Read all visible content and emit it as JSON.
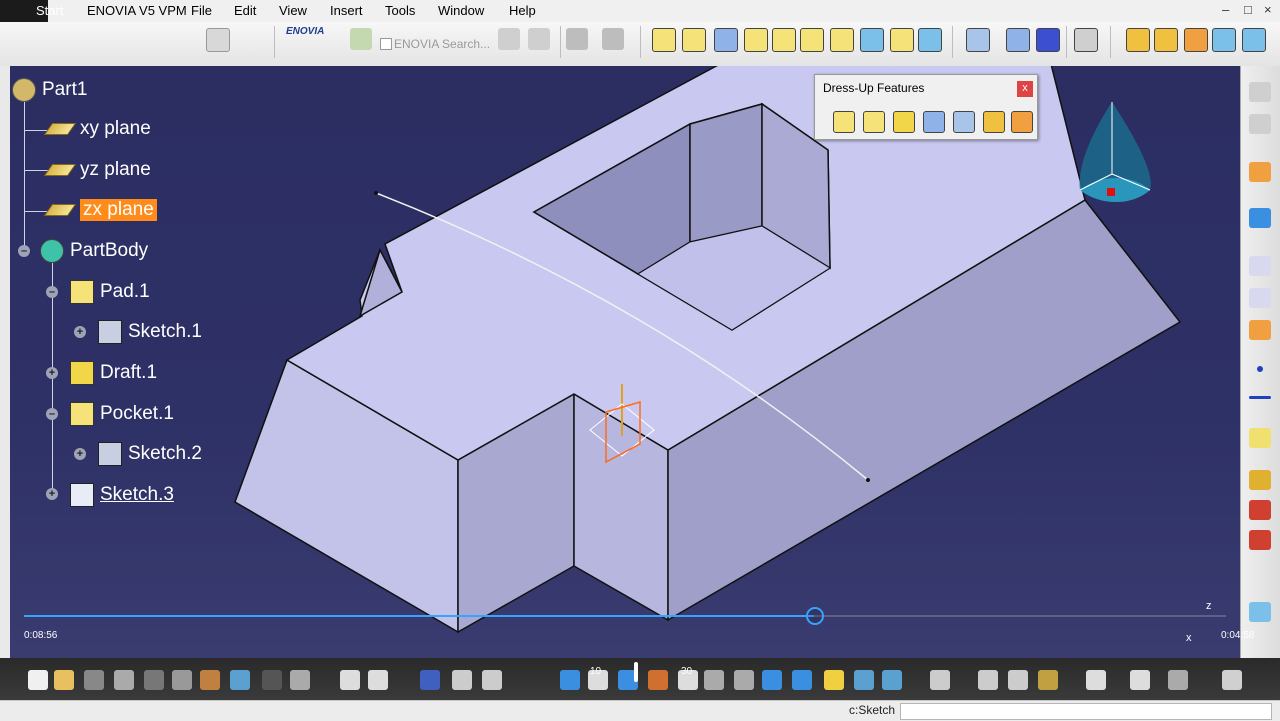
{
  "menubar": {
    "start_label": "Start",
    "app_title": "ENOVIA V5 VPM",
    "items": [
      "File",
      "Edit",
      "View",
      "Insert",
      "Tools",
      "Window",
      "Help"
    ],
    "window_controls": [
      "–",
      "□",
      "×"
    ]
  },
  "toolbar": {
    "enovia_logo": "ENOVIA",
    "enovia_search": "ENOVIA Search..."
  },
  "tree": {
    "root": "Part1",
    "planes": [
      "xy plane",
      "yz plane",
      "zx plane"
    ],
    "body": "PartBody",
    "features": [
      {
        "label": "Pad.1",
        "child": "Sketch.1"
      },
      {
        "label": "Draft.1"
      },
      {
        "label": "Pocket.1",
        "child": "Sketch.2"
      },
      {
        "label": "Sketch.3"
      }
    ]
  },
  "dress_up": {
    "title": "Dress-Up Features",
    "close": "x"
  },
  "video": {
    "elapsed": "0:08:56",
    "remaining": "0:04:58",
    "progress": 0.657,
    "rewind_label": "10",
    "forward_label": "30"
  },
  "axis_labels": {
    "z": "z",
    "x": "x"
  },
  "status": {
    "text": "c:Sketch"
  },
  "colors": {
    "accent": "#38a3ff",
    "highlight": "#ff8c1a",
    "background": "#2d2f63",
    "part_face": "#c9c9ef"
  }
}
